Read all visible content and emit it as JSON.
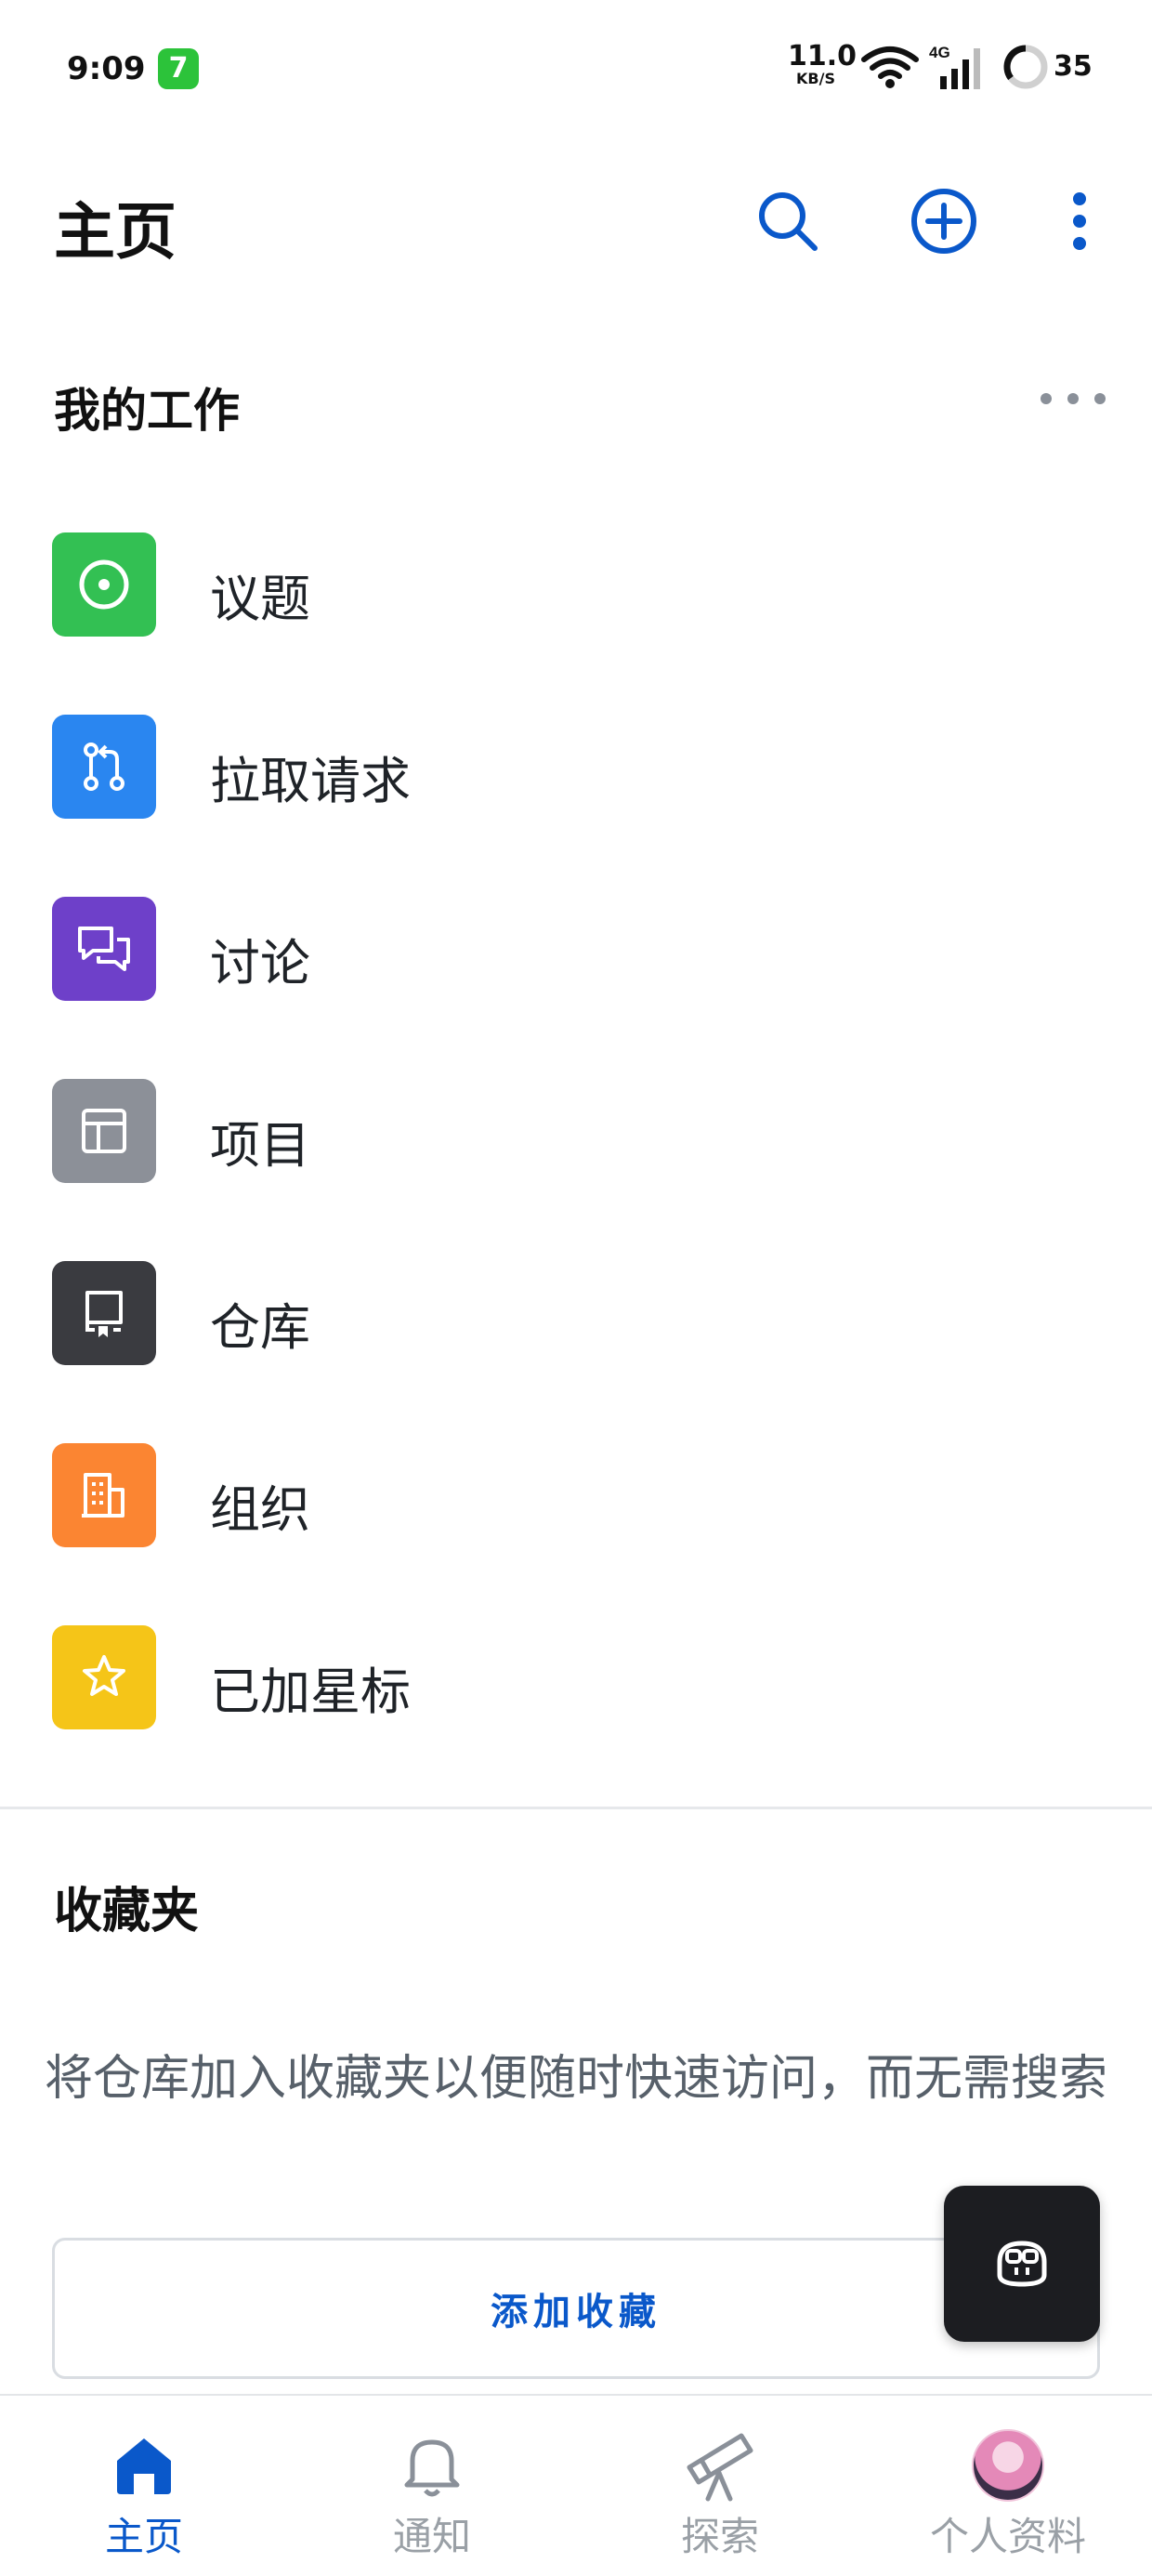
{
  "status_bar": {
    "time": "9:09",
    "app_badge": "7",
    "net_speed_value": "11.0",
    "net_speed_unit": "KB/S",
    "network_type": "4G",
    "battery_percent": "35"
  },
  "header": {
    "title": "主页",
    "search_icon": "search-icon",
    "add_icon": "plus-circle-icon",
    "more_icon": "kebab-menu-icon"
  },
  "my_work": {
    "title": "我的工作",
    "items": [
      {
        "label": "议题",
        "icon": "issue-icon",
        "color": "#33c053"
      },
      {
        "label": "拉取请求",
        "icon": "pull-request-icon",
        "color": "#2a86f0"
      },
      {
        "label": "讨论",
        "icon": "discussion-icon",
        "color": "#6e40c9"
      },
      {
        "label": "项目",
        "icon": "project-table-icon",
        "color": "#8c9098"
      },
      {
        "label": "仓库",
        "icon": "repository-icon",
        "color": "#3a3b40"
      },
      {
        "label": "组织",
        "icon": "organization-icon",
        "color": "#fb8532"
      },
      {
        "label": "已加星标",
        "icon": "star-icon",
        "color": "#f5c518"
      }
    ]
  },
  "favorites": {
    "title": "收藏夹",
    "description": "将仓库加入收藏夹以便随时快速访问，而无需搜索",
    "add_button": "添加收藏"
  },
  "bottom_nav": [
    {
      "label": "主页",
      "icon": "home-icon",
      "active": true
    },
    {
      "label": "通知",
      "icon": "bell-icon",
      "active": false
    },
    {
      "label": "探索",
      "icon": "telescope-icon",
      "active": false
    },
    {
      "label": "个人资料",
      "icon": "avatar",
      "active": false
    }
  ],
  "colors": {
    "accent": "#0a58ca"
  }
}
